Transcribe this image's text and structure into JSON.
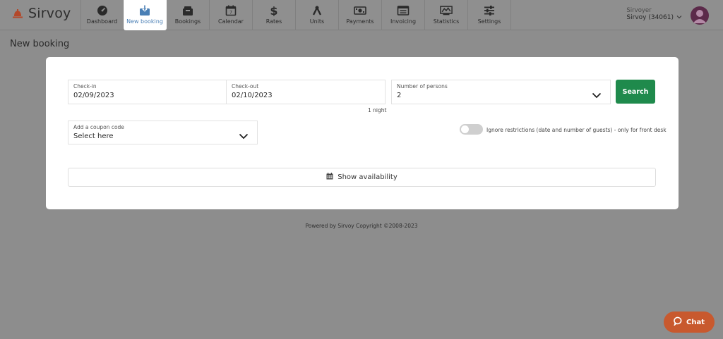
{
  "app": {
    "name": "Sirvoy"
  },
  "nav": {
    "items": [
      {
        "label": "Dashboard",
        "icon": "dashboard-icon"
      },
      {
        "label": "New booking",
        "icon": "new-booking-icon",
        "active": true
      },
      {
        "label": "Bookings",
        "icon": "bookings-icon"
      },
      {
        "label": "Calendar",
        "icon": "calendar-icon"
      },
      {
        "label": "Rates",
        "icon": "dollar-icon"
      },
      {
        "label": "Units",
        "icon": "units-icon"
      },
      {
        "label": "Payments",
        "icon": "payments-icon"
      },
      {
        "label": "Invoicing",
        "icon": "invoicing-icon"
      },
      {
        "label": "Statistics",
        "icon": "statistics-icon"
      },
      {
        "label": "Settings",
        "icon": "settings-icon"
      }
    ]
  },
  "user": {
    "role": "Sirvoyer",
    "account": "Sirvoy (34061)"
  },
  "page": {
    "title": "New booking"
  },
  "form": {
    "checkin": {
      "label": "Check-in",
      "value": "02/09/2023"
    },
    "checkout": {
      "label": "Check-out",
      "value": "02/10/2023"
    },
    "nights": "1 night",
    "persons": {
      "label": "Number of persons",
      "value": "2"
    },
    "search_label": "Search",
    "coupon": {
      "label": "Add a coupon code",
      "value": "Select here"
    },
    "ignore_restrictions": {
      "label": "Ignore restrictions (date and number of guests) - only for front desk",
      "checked": false
    },
    "show_availability_label": "Show availability"
  },
  "footer": {
    "text": "Powered by Sirvoy Copyright ©2008-2023"
  },
  "chat": {
    "label": "Chat"
  },
  "colors": {
    "primary_green": "#1f8a4c",
    "chat_orange": "#c8592e",
    "accent_blue": "#4a7fb5",
    "logo_red": "#c8502a"
  }
}
